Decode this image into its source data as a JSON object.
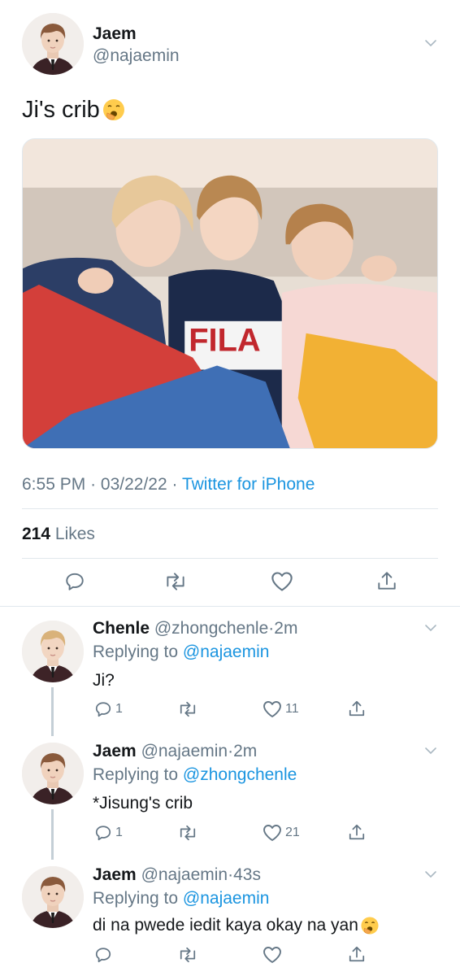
{
  "tweet": {
    "name": "Jaem",
    "handle": "@najaemin",
    "text": "Ji's crib",
    "emoji": "yawning-face-emoji",
    "time": "6:55 PM",
    "date": "03/22/22",
    "source": "Twitter for iPhone",
    "likes_count": "214",
    "likes_label": "Likes",
    "photo_name": "group-photo"
  },
  "replies": [
    {
      "name": "Chenle",
      "handle": "@zhongchenle",
      "time": "2m",
      "replying_prefix": "Replying to",
      "replying_to": "@najaemin",
      "text": "Ji?",
      "reply_count": "1",
      "retweet_count": "",
      "like_count": "11"
    },
    {
      "name": "Jaem",
      "handle": "@najaemin",
      "time": "2m",
      "replying_prefix": "Replying to",
      "replying_to": "@zhongchenle",
      "text": "*Jisung's crib",
      "reply_count": "1",
      "retweet_count": "",
      "like_count": "21"
    },
    {
      "name": "Jaem",
      "handle": "@najaemin",
      "time": "43s",
      "replying_prefix": "Replying to",
      "replying_to": "@najaemin",
      "text": "di na pwede iedit kaya okay na yan",
      "emoji": "yawning-face-emoji",
      "reply_count": "",
      "retweet_count": "",
      "like_count": ""
    }
  ],
  "separator": "·",
  "colors": {
    "link": "#1b95e0",
    "secondary_text": "#657786",
    "primary_text": "#14171a",
    "divider": "#e1e8ed",
    "thread_line": "#c4cfd6"
  }
}
